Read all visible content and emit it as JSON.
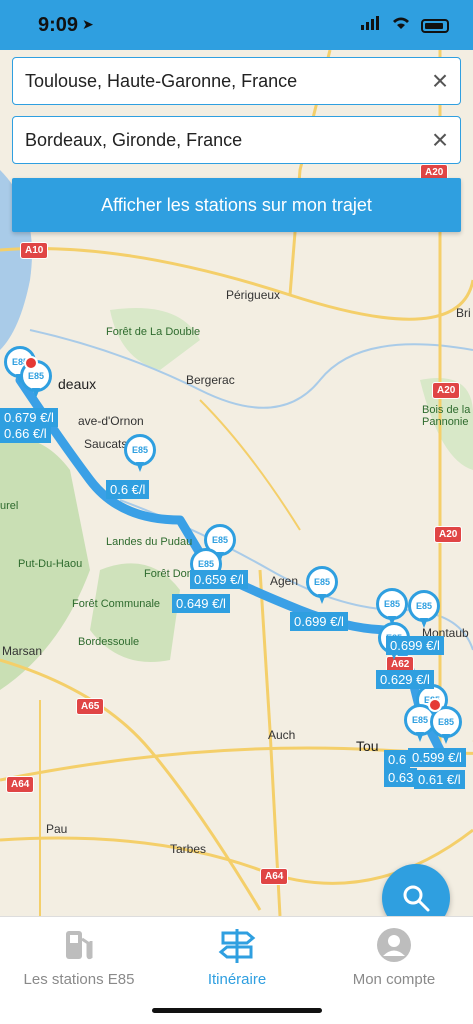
{
  "status": {
    "time": "9:09"
  },
  "origin_field": {
    "value": "Toulouse, Haute-Garonne, France"
  },
  "destination_field": {
    "value": "Bordeaux, Gironde, France"
  },
  "search_button": {
    "label": "Afficher les stations sur mon trajet"
  },
  "map": {
    "places": [
      {
        "name": "Périgueux",
        "cls": ""
      },
      {
        "name": "Forêt de La Double",
        "cls": "green"
      },
      {
        "name": "Bergerac",
        "cls": ""
      },
      {
        "name": "deaux",
        "cls": "big"
      },
      {
        "name": "ave-d'Ornon",
        "cls": ""
      },
      {
        "name": "Saucats",
        "cls": ""
      },
      {
        "name": "Landes du Pudau",
        "cls": "green"
      },
      {
        "name": "Put-Du-Haou",
        "cls": "green"
      },
      {
        "name": "Forêt Communale",
        "cls": "green"
      },
      {
        "name": "Bordessoule",
        "cls": "green"
      },
      {
        "name": "Marsan",
        "cls": ""
      },
      {
        "name": "Agen",
        "cls": ""
      },
      {
        "name": "Montaub",
        "cls": ""
      },
      {
        "name": "Auch",
        "cls": ""
      },
      {
        "name": "Tou",
        "cls": "big"
      },
      {
        "name": "Pau",
        "cls": ""
      },
      {
        "name": "Tarbes",
        "cls": ""
      },
      {
        "name": "Bois de la Pannonie",
        "cls": "green"
      },
      {
        "name": "Bri",
        "cls": ""
      },
      {
        "name": "urel",
        "cls": "green"
      },
      {
        "name": "Forêt Don",
        "cls": "green"
      }
    ],
    "roads": [
      "A10",
      "A20",
      "A20",
      "A20",
      "A62",
      "A65",
      "A64",
      "A64"
    ],
    "prices": [
      "0.6 €/l",
      "0.659 €/l",
      "0.649 €/l",
      "0.699 €/l",
      "0.699 €/l",
      "0.629 €/l",
      "0.599 €/l",
      "0.61 €/l",
      "0.679 €/l",
      "0.66 €/l",
      "0.63",
      "0.6"
    ],
    "pin_label": "E85"
  },
  "tabs": [
    {
      "label": "Les stations E85",
      "icon": "fuel-pump-icon",
      "active": false
    },
    {
      "label": "Itinéraire",
      "icon": "signpost-icon",
      "active": true
    },
    {
      "label": "Mon compte",
      "icon": "account-icon",
      "active": false
    }
  ],
  "colors": {
    "accent": "#2f9fe0",
    "route": "#3aa0e6",
    "road_shield": "#e04545"
  }
}
